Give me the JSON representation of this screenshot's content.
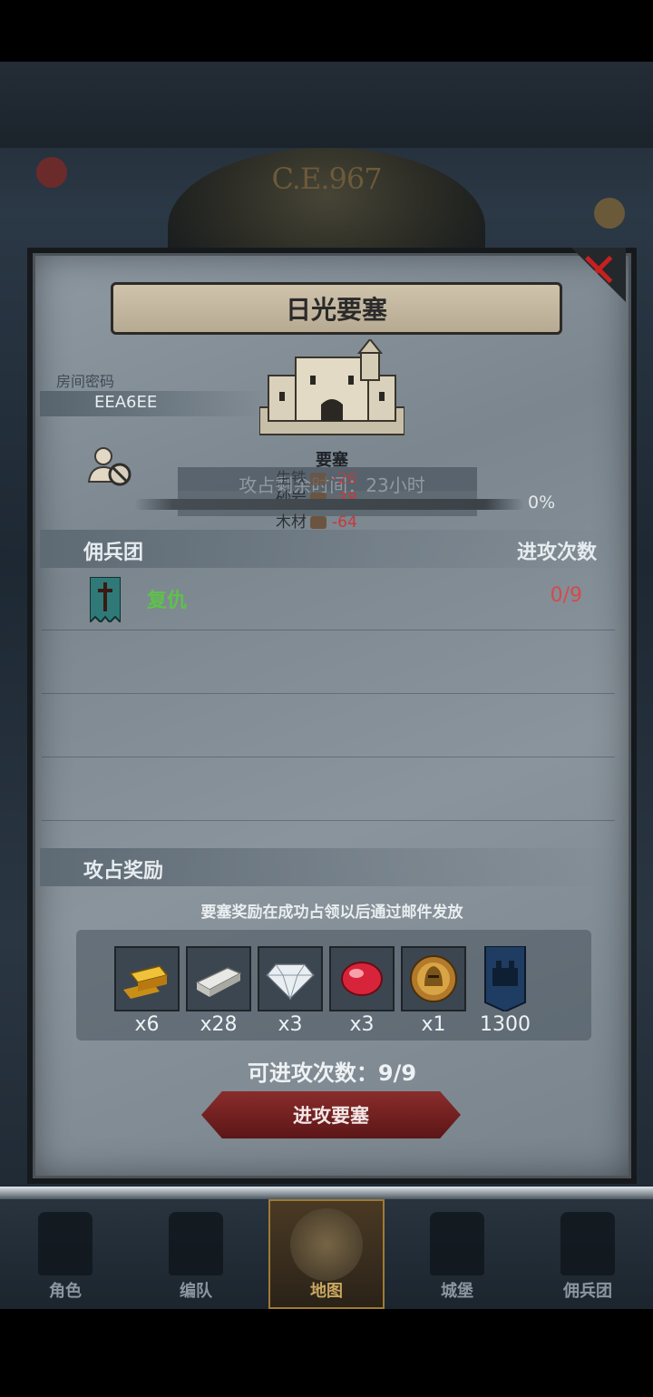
{
  "header": {
    "year": "C.E.967"
  },
  "dialog": {
    "title": "日光要塞",
    "room_label": "房间密码",
    "room_code": "EEA6EE",
    "fortress_label": "要塞",
    "conquer_time_text": "攻占剩余时间：23小时",
    "resources": [
      {
        "name": "生铁",
        "value": "-26"
      },
      {
        "name": "砂岩",
        "value": "-38"
      },
      {
        "name": "木材",
        "value": "-64"
      }
    ],
    "progress": {
      "percent_value": 0,
      "label": "0%"
    },
    "merc_section": {
      "title": "佣兵团",
      "attacks_header": "进攻次数"
    },
    "mercenaries": [
      {
        "name": "复仇",
        "count": "0/9",
        "banner_color": "#2f7a78"
      }
    ],
    "reward_section": {
      "title": "攻占奖励",
      "note": "要塞奖励在成功占领以后通过邮件发放",
      "items": [
        {
          "icon": "gold-bar-icon",
          "count": "x6"
        },
        {
          "icon": "iron-bar-icon",
          "count": "x28"
        },
        {
          "icon": "diamond-icon",
          "count": "x3"
        },
        {
          "icon": "ruby-icon",
          "count": "x3"
        },
        {
          "icon": "knight-medal-icon",
          "count": "x1"
        },
        {
          "icon": "fortress-banner-icon",
          "count": "1300"
        }
      ]
    },
    "attack_count": "可进攻次数：9/9",
    "attack_button": "进攻要塞"
  },
  "nav": [
    {
      "label": "角色",
      "icon": "character-icon"
    },
    {
      "label": "编队",
      "icon": "formation-icon"
    },
    {
      "label": "地图",
      "icon": "map-icon",
      "active": true
    },
    {
      "label": "城堡",
      "icon": "castle-icon"
    },
    {
      "label": "佣兵团",
      "icon": "mercenary-icon"
    }
  ],
  "colors": {
    "accent_red": "#c81f1f",
    "merc_green": "#5ec24a",
    "count_red": "#d64a4a"
  }
}
